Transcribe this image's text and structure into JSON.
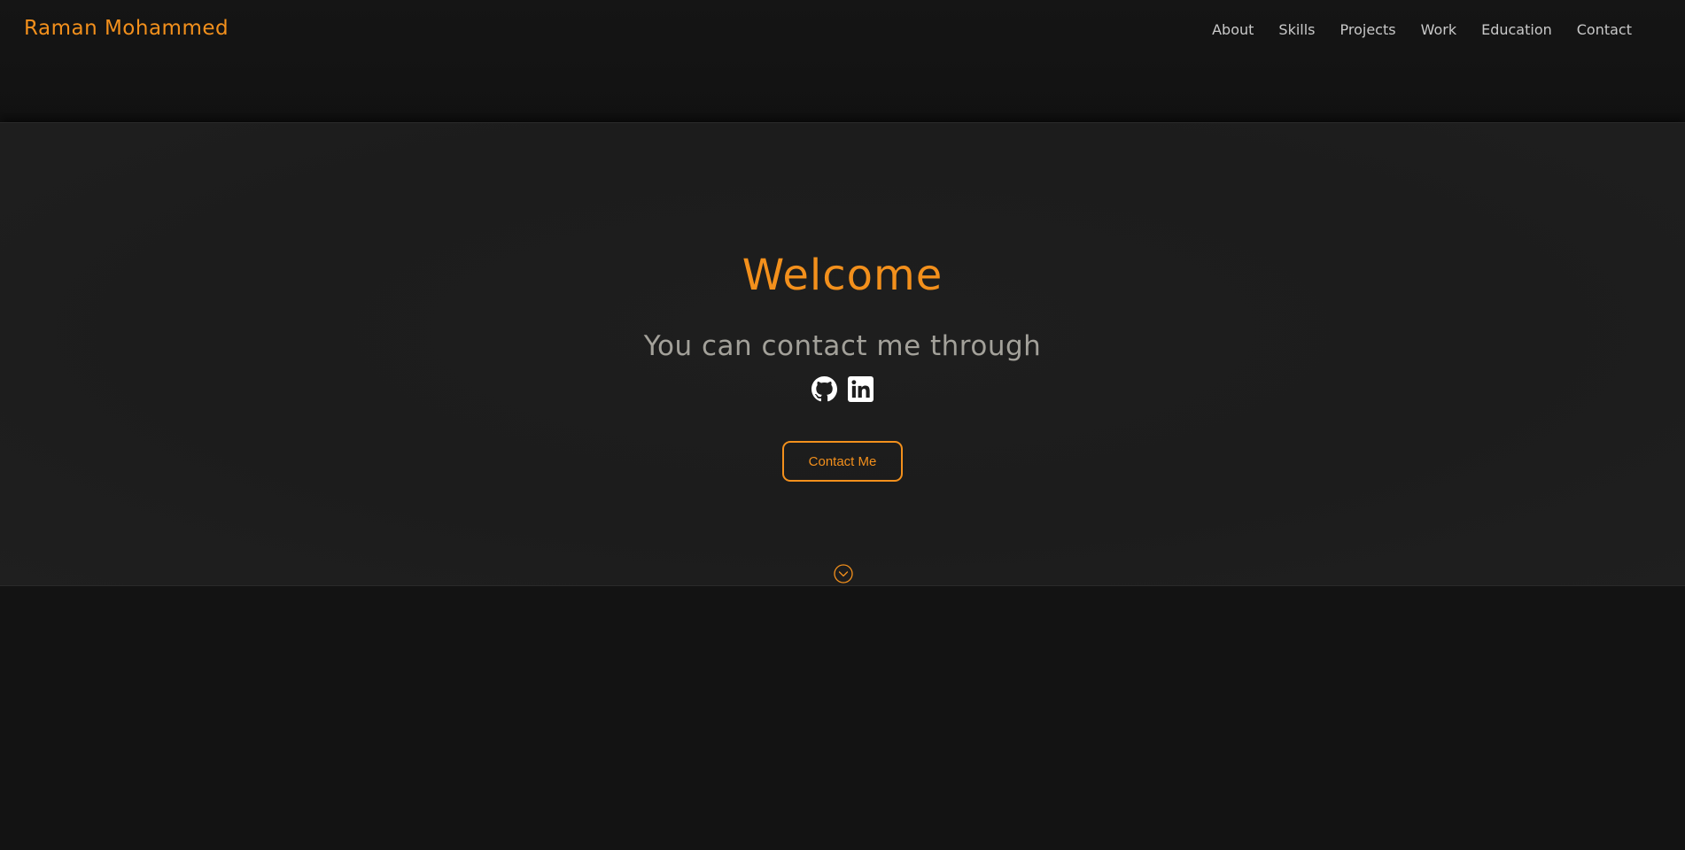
{
  "header": {
    "brand": "Raman Mohammed",
    "nav": [
      {
        "label": "About"
      },
      {
        "label": "Skills"
      },
      {
        "label": "Projects"
      },
      {
        "label": "Work"
      },
      {
        "label": "Education"
      },
      {
        "label": "Contact"
      }
    ]
  },
  "hero": {
    "title": "Welcome",
    "subtitle": "You can contact me through",
    "socials": [
      {
        "icon": "github-icon"
      },
      {
        "icon": "linkedin-icon"
      }
    ],
    "cta_label": "Contact Me",
    "scroll_icon": "chevron-down-circle-icon"
  },
  "colors": {
    "accent": "#f3901c",
    "background": "#131313",
    "hero_background": "#1d1d1d",
    "nav_text": "#c9c9c9",
    "subtitle_text": "#a3a19a",
    "icon": "#ffffff"
  }
}
